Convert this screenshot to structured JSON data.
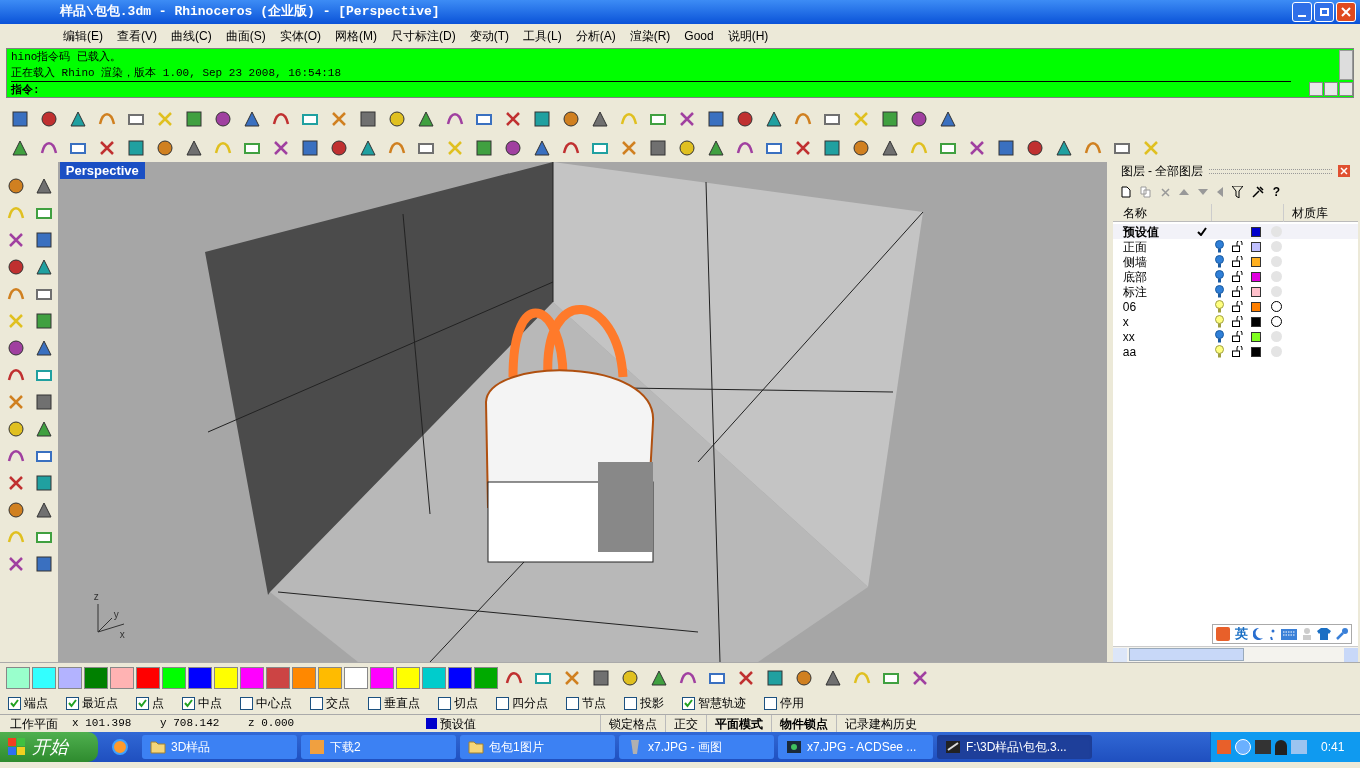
{
  "window": {
    "title": "样品\\包包.3dm - Rhinoceros (企业版) - [Perspective]"
  },
  "menu": [
    "编辑(E)",
    "查看(V)",
    "曲线(C)",
    "曲面(S)",
    "实体(O)",
    "网格(M)",
    "尺寸标注(D)",
    "变动(T)",
    "工具(L)",
    "分析(A)",
    "渲染(R)",
    "Good",
    "说明(H)"
  ],
  "command": {
    "history": [
      "hino指令码 已载入。",
      "正在载入 Rhino 渲染，版本 1.00, Sep 23 2008, 16:54:18"
    ],
    "prompt": "指令:"
  },
  "viewport": {
    "label": "Perspective",
    "axis_labels": [
      "z",
      "y",
      "x"
    ]
  },
  "layers": {
    "title": "图层 - 全部图层",
    "help": "?",
    "columns": [
      "名称",
      "材质库"
    ],
    "rows": [
      {
        "name": "预设值",
        "current": true,
        "color": "#0000cc",
        "has_material": false
      },
      {
        "name": "正面",
        "current": false,
        "lit": false,
        "color": "#c0c0ff",
        "has_material": false
      },
      {
        "name": "侧墙",
        "current": false,
        "lit": false,
        "color": "#ffb020",
        "has_material": false
      },
      {
        "name": "底部",
        "current": false,
        "lit": false,
        "color": "#e000e0",
        "has_material": false
      },
      {
        "name": "标注",
        "current": false,
        "lit": false,
        "color": "#ffc0cb",
        "has_material": false
      },
      {
        "name": "06",
        "current": false,
        "lit": true,
        "color": "#ff7f00",
        "has_material": true
      },
      {
        "name": "x",
        "current": false,
        "lit": true,
        "color": "#000000",
        "has_material": true
      },
      {
        "name": "xx",
        "current": false,
        "lit": false,
        "color": "#80ff20",
        "has_material": false
      },
      {
        "name": "aa",
        "current": false,
        "lit": true,
        "color": "#000000",
        "has_material": false
      }
    ],
    "ime_label": "英"
  },
  "snaps": [
    {
      "label": "端点",
      "checked": true
    },
    {
      "label": "最近点",
      "checked": true
    },
    {
      "label": "点",
      "checked": true
    },
    {
      "label": "中点",
      "checked": true
    },
    {
      "label": "中心点",
      "checked": false
    },
    {
      "label": "交点",
      "checked": false
    },
    {
      "label": "垂直点",
      "checked": false
    },
    {
      "label": "切点",
      "checked": false
    },
    {
      "label": "四分点",
      "checked": false
    },
    {
      "label": "节点",
      "checked": false
    },
    {
      "label": "投影",
      "checked": false
    },
    {
      "label": "智慧轨迹",
      "checked": true
    },
    {
      "label": "停用",
      "checked": false
    }
  ],
  "status": {
    "plane": "工作平面",
    "x": "x 101.398",
    "y": "y 708.142",
    "z": "z 0.000",
    "layer": "预设值",
    "toggles": [
      {
        "label": "锁定格点",
        "on": false
      },
      {
        "label": "正交",
        "on": false
      },
      {
        "label": "平面模式",
        "on": true
      },
      {
        "label": "物件锁点",
        "on": true
      },
      {
        "label": "记录建构历史",
        "on": false
      }
    ]
  },
  "taskbar": {
    "start": "开始",
    "tasks": [
      {
        "label": "3D样品",
        "kind": "folder",
        "selected": false
      },
      {
        "label": "下载2",
        "kind": "download",
        "selected": false
      },
      {
        "label": "包包1图片",
        "kind": "folder",
        "selected": false
      },
      {
        "label": "x7.JPG - 画图",
        "kind": "paint",
        "selected": false
      },
      {
        "label": "x7.JPG - ACDSee ...",
        "kind": "viewer",
        "selected": false
      },
      {
        "label": "F:\\3D样品\\包包.3...",
        "kind": "rhino",
        "selected": true
      }
    ],
    "clock": "0:41"
  }
}
